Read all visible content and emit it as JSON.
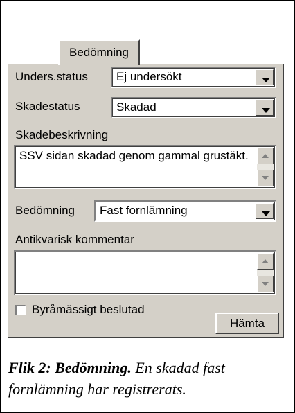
{
  "tab": {
    "label": "Bedömning"
  },
  "fields": {
    "unders_status": {
      "label": "Unders.status",
      "value": "Ej undersökt"
    },
    "skadestatus": {
      "label": "Skadestatus",
      "value": "Skadad"
    },
    "skadebeskrivning": {
      "label": "Skadebeskrivning",
      "value": "SSV sidan skadad genom gammal grustäkt."
    },
    "bedomning": {
      "label": "Bedömning",
      "value": "Fast fornlämning"
    },
    "antikvarisk_kommentar": {
      "label": "Antikvarisk kommentar",
      "value": ""
    }
  },
  "checkbox": {
    "label": "Byråmässigt beslutad",
    "checked": false
  },
  "button": {
    "label": "Hämta"
  },
  "caption": {
    "bold": "Flik 2: Bedömning.",
    "text": " En skadad fast fornlämning har registrerats."
  }
}
